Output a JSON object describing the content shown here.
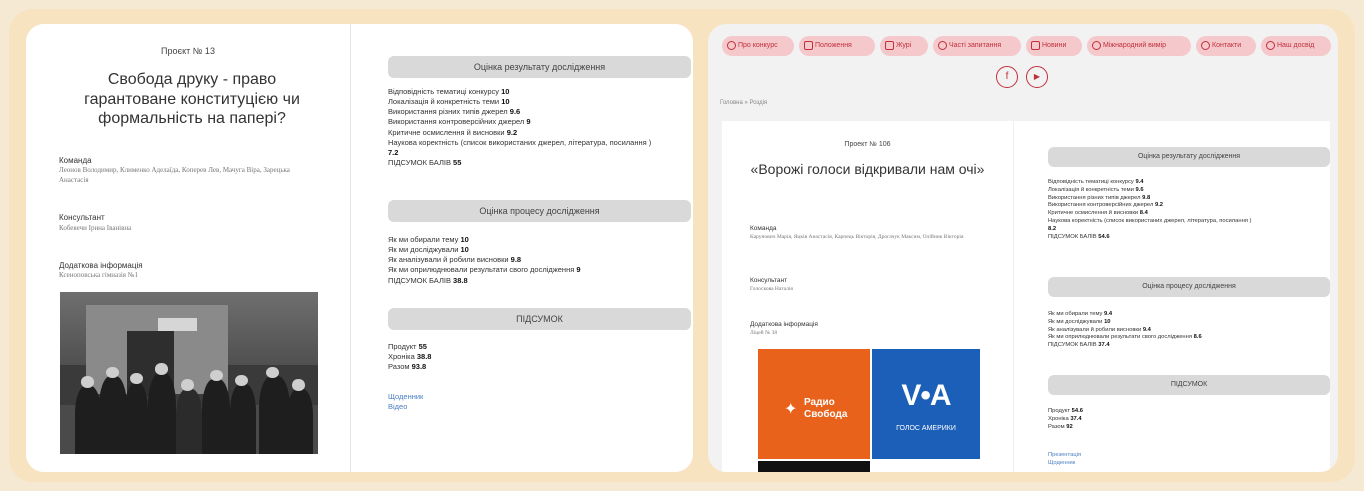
{
  "left": {
    "project_number": "Проєкт № 13",
    "title": "Свобода друку - право гарантоване конституцією чи формальність на папері?",
    "team_label": "Команда",
    "team_value": "Леонов Володимир, Клименко Аделаїда, Коперев Лев, Мачуга Віра, Зарецька Анастасія",
    "consultant_label": "Консультант",
    "consultant_value": "Кобевечи Ірина Іванівна",
    "extra_label": "Додаткова інформація",
    "extra_value": "Ксеноповська гімназія №1",
    "photo_sign": "Разом ШАНХ",
    "result_header": "Оцінка результату дослідження",
    "result_items": [
      {
        "label": "Відповідність тематиці конкурсу",
        "score": "10"
      },
      {
        "label": "Локалізація й конкретність теми",
        "score": "10"
      },
      {
        "label": "Використання різних типів джерел",
        "score": "9.6"
      },
      {
        "label": "Використання контроверсійних джерел",
        "score": "9"
      },
      {
        "label": "Критичне осмислення й висновки",
        "score": "9.2"
      },
      {
        "label": "Наукова коректність (список використаних джерел, література, посилання )",
        "score": "7.2"
      }
    ],
    "result_total_label": "ПІДСУМОК БАЛІВ",
    "result_total": "55",
    "process_header": "Оцінка процесу дослідження",
    "process_items": [
      {
        "label": "Як ми обирали тему",
        "score": "10"
      },
      {
        "label": "Як ми досліджували",
        "score": "10"
      },
      {
        "label": "Як аналізували й робили висновки",
        "score": "9.8"
      },
      {
        "label": "Як ми оприлюднювали результати свого дослідження",
        "score": "9"
      }
    ],
    "process_total_label": "ПІДСУМОК БАЛІВ",
    "process_total": "38.8",
    "summary_header": "ПІДСУМОК",
    "summary_items": [
      {
        "label": "Продукт",
        "score": "55"
      },
      {
        "label": "Хроніка",
        "score": "38.8"
      },
      {
        "label": "Разом",
        "score": "93.8"
      }
    ],
    "links": [
      "Щоденник",
      "Відео"
    ]
  },
  "right": {
    "nav": [
      {
        "label": "Про конкурс",
        "icon": "info-icon"
      },
      {
        "label": "Положення",
        "icon": "people-icon"
      },
      {
        "label": "Журі",
        "icon": "people-icon"
      },
      {
        "label": "Часті запитання",
        "icon": "question-icon"
      },
      {
        "label": "Новини",
        "icon": "news-icon"
      },
      {
        "label": "Міжнародний вимір",
        "icon": "globe-icon"
      },
      {
        "label": "Контакти",
        "icon": "phone-icon"
      },
      {
        "label": "Наш досвід",
        "icon": "globe-icon"
      }
    ],
    "social": [
      "f",
      "▶"
    ],
    "breadcrumb": "Головна  »  Роздія",
    "project_number": "Проект № 106",
    "title": "«Ворожі голоси відкривали нам очі»",
    "team_label": "Команда",
    "team_value": "Карунович Марія, Яцків Анастасія, Карпець Вікторія, Дрогачук Максим, Олійник Вікторія",
    "consultant_label": "Консультант",
    "consultant_value": "Голоскова Наталія",
    "extra_label": "Додаткова інформація",
    "extra_value": "Ліцей № 38",
    "tile_rs_line1": "Радио",
    "tile_rs_line2": "Свобода",
    "tile_voa_big": "V•A",
    "tile_voa_small": "ГОЛОС АМЕРИКИ",
    "result_header": "Оцінка результату дослідження",
    "result_items": [
      {
        "label": "Відповідність тематиці конкурсу",
        "score": "9.4"
      },
      {
        "label": "Локалізація й конкретність теми",
        "score": "9.6"
      },
      {
        "label": "Використання різних типів джерел",
        "score": "9.8"
      },
      {
        "label": "Використання контроверсійних джерел",
        "score": "9.2"
      },
      {
        "label": "Критичне осмислення й висновки",
        "score": "8.4"
      },
      {
        "label": "Наукова коректність (список використаних джерел, література, посилання )",
        "score": "8.2"
      }
    ],
    "result_total_label": "ПІДСУМОК БАЛІВ",
    "result_total": "54.6",
    "process_header": "Оцінка процесу дослідження",
    "process_items": [
      {
        "label": "Як ми обирали тему",
        "score": "9.4"
      },
      {
        "label": "Як ми досліджували",
        "score": "10"
      },
      {
        "label": "Як аналізували й робили висновки",
        "score": "9.4"
      },
      {
        "label": "Як ми оприлюднювали результати свого дослідження",
        "score": "8.6"
      }
    ],
    "process_total_label": "ПІДСУМОК БАЛІВ",
    "process_total": "37.4",
    "summary_header": "ПІДСУМОК",
    "summary_items": [
      {
        "label": "Продукт",
        "score": "54.6"
      },
      {
        "label": "Хроніка",
        "score": "37.4"
      },
      {
        "label": "Разом",
        "score": "92"
      }
    ],
    "links": [
      "Презентація",
      "Щоденник"
    ]
  }
}
